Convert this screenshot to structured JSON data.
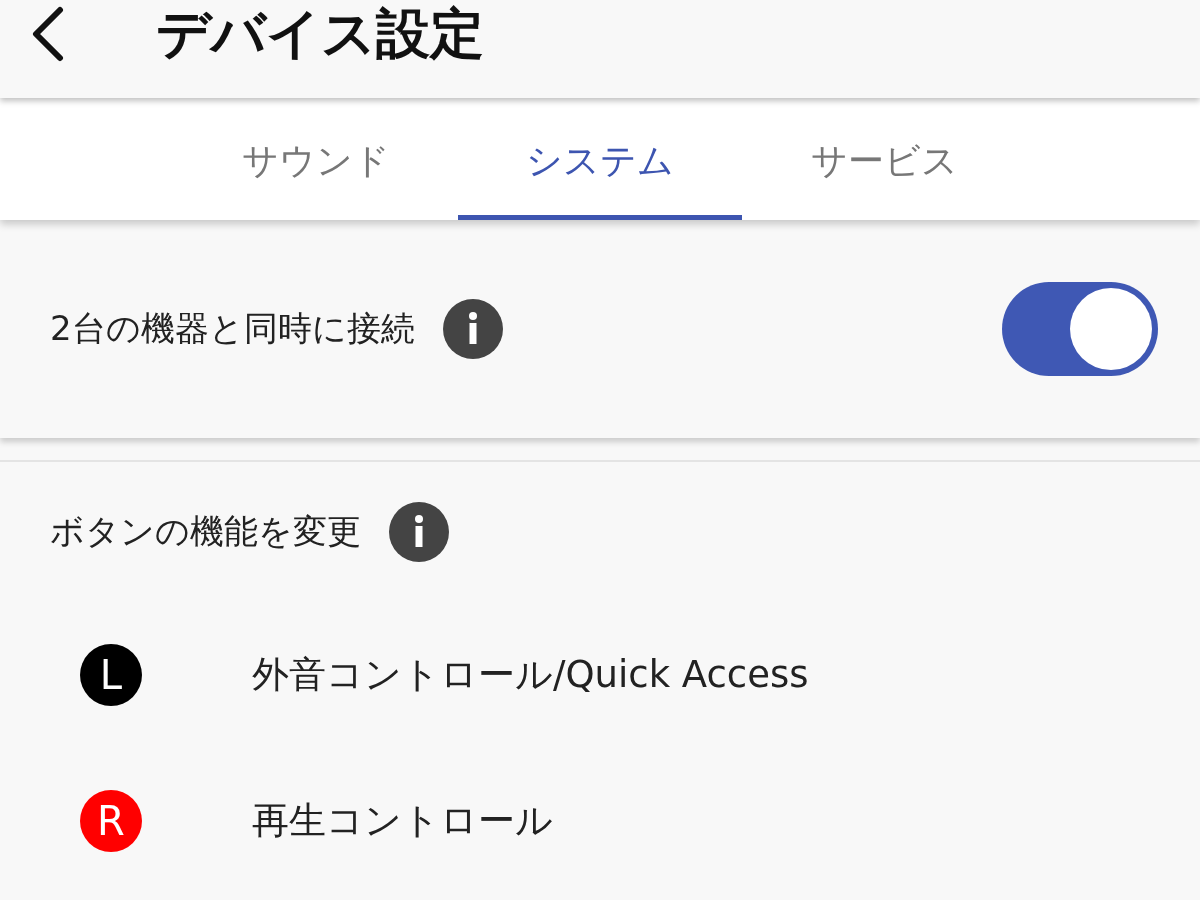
{
  "header": {
    "title": "デバイス設定"
  },
  "tabs": [
    {
      "label": "サウンド",
      "selected": false
    },
    {
      "label": "システム",
      "selected": true
    },
    {
      "label": "サービス",
      "selected": false
    }
  ],
  "multipoint": {
    "label": "2台の機器と同時に接続",
    "on": true
  },
  "button_function": {
    "title": "ボタンの機能を変更",
    "items": [
      {
        "badge": "L",
        "color": "#000000",
        "label": "外音コントロール/Quick Access"
      },
      {
        "badge": "R",
        "color": "#ff0000",
        "label": "再生コントロール"
      }
    ]
  }
}
